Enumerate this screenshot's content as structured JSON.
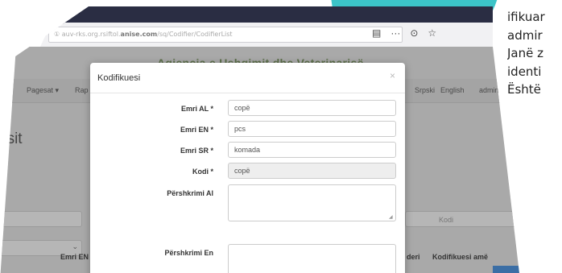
{
  "browser": {
    "tab_dot": "·",
    "new_tab": "+",
    "url_prefix": "① ",
    "url_pre": "auv-rks.org.rsiftol.",
    "url_host": "anise.com",
    "url_path": "/sq/Codifier/CodifierList",
    "icons": {
      "reader": "▤",
      "more": "···",
      "pocket": "⊙",
      "bookmark": "☆"
    }
  },
  "site": {
    "title": "Agjencia e Ushqimit dhe Veterinarisë",
    "nav": {
      "left_partial": "i ▾",
      "pagesat": "Pagesat ▾",
      "raporte": "Rap",
      "srpski": "Srpski",
      "english": "English",
      "admin": "admin"
    },
    "page_heading": "esit",
    "kodi_placeholder": "Kodi",
    "select_arrow": "⌄",
    "columns": {
      "emri_en": "Emri EN",
      "deri": "deri",
      "kodifikuesi_ame": "Kodifikuesi amë"
    }
  },
  "modal": {
    "title": "Kodifikuesi",
    "close": "×",
    "fields": {
      "emri_al": {
        "label": "Emri AL *",
        "value": "copë"
      },
      "emri_en": {
        "label": "Emri EN *",
        "value": "pcs"
      },
      "emri_sr": {
        "label": "Emri SR *",
        "value": "komada"
      },
      "kodi": {
        "label": "Kodi *",
        "value": "copë"
      },
      "pershkrimi_al": {
        "label": "Përshkrimi Al",
        "value": ""
      },
      "pershkrimi_en": {
        "label": "Përshkrimi En",
        "value": ""
      }
    }
  },
  "side_text": [
    "ifikuar",
    "admir",
    "Janë z",
    "identi",
    "Është"
  ],
  "colors": {
    "accent_teal": "#3cc4c8",
    "tabbar": "#2a2d43"
  }
}
